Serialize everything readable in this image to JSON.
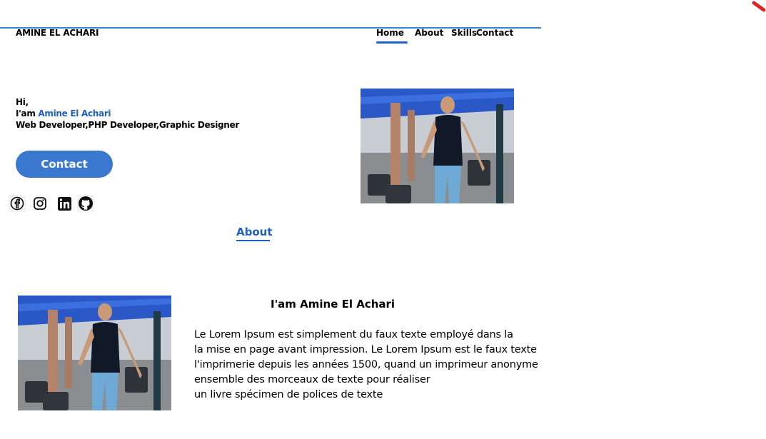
{
  "header": {
    "brand": "AMINE EL ACHARI",
    "nav": [
      "Home",
      "About",
      "Skills",
      "Contact"
    ],
    "accent_color": "#1e5fc8",
    "rule_color": "#2f86d6"
  },
  "hero": {
    "greeting": "Hi,",
    "iam_prefix": "I'am ",
    "name": "Amine El Achari",
    "roles": "Web Developer,PHP Developer,Graphic Designer",
    "contact_button": "Contact",
    "social_icons": [
      "facebook-icon",
      "instagram-icon",
      "linkedin-icon",
      "github-icon"
    ]
  },
  "about": {
    "section_title": "About",
    "heading": "I'am Amine El Achari",
    "paragraph_lines": [
      "Le Lorem Ipsum est simplement du faux texte employé dans la",
      "la mise en page avant impression. Le Lorem Ipsum est le faux texte",
      "l'imprimerie depuis les années 1500, quand un imprimeur anonyme",
      "ensemble des morceaux de texte pour réaliser",
      "un livre spécimen de polices de texte"
    ]
  }
}
